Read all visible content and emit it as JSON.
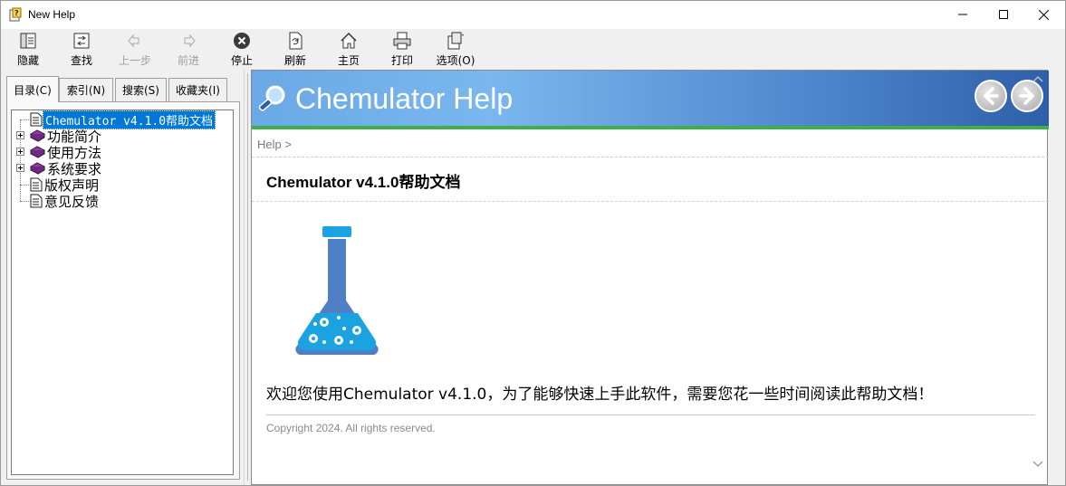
{
  "window": {
    "title": "New Help"
  },
  "toolbar": {
    "items": [
      {
        "label": "隐藏",
        "icon": "hide-icon",
        "enabled": true
      },
      {
        "label": "查找",
        "icon": "locate-icon",
        "enabled": true
      },
      {
        "label": "上一步",
        "icon": "back-arrow-icon",
        "enabled": false
      },
      {
        "label": "前进",
        "icon": "forward-arrow-icon",
        "enabled": false
      },
      {
        "label": "停止",
        "icon": "stop-icon",
        "enabled": true
      },
      {
        "label": "刷新",
        "icon": "refresh-icon",
        "enabled": true
      },
      {
        "label": "主页",
        "icon": "home-icon",
        "enabled": true
      },
      {
        "label": "打印",
        "icon": "print-icon",
        "enabled": true
      },
      {
        "label": "选项(O)",
        "icon": "options-icon",
        "enabled": true
      }
    ]
  },
  "nav": {
    "tabs": [
      {
        "label": "目录(C)",
        "active": true
      },
      {
        "label": "索引(N)",
        "active": false
      },
      {
        "label": "搜索(S)",
        "active": false
      },
      {
        "label": "收藏夹(I)",
        "active": false
      }
    ],
    "tree": [
      {
        "label": "Chemulator v4.1.0帮助文档",
        "type": "page",
        "selected": true
      },
      {
        "label": "功能简介",
        "type": "book",
        "expandable": true
      },
      {
        "label": "使用方法",
        "type": "book",
        "expandable": true
      },
      {
        "label": "系统要求",
        "type": "book",
        "expandable": true
      },
      {
        "label": "版权声明",
        "type": "page"
      },
      {
        "label": "意见反馈",
        "type": "page"
      }
    ]
  },
  "content": {
    "banner_title": "Chemulator Help",
    "breadcrumb": "Help >",
    "doc_title": "Chemulator v4.1.0帮助文档",
    "welcome": "欢迎您使用Chemulator v4.1.0，为了能够快速上手此软件，需要您花一些时间阅读此帮助文档！",
    "copyright": "Copyright  2024. All rights reserved."
  },
  "colors": {
    "selection": "#0078d7",
    "banner_start": "#6aa9e6",
    "banner_end": "#2e5fa8",
    "banner_accent": "#3db04a",
    "flask_blue": "#4f7fc4",
    "flask_liquid": "#1aa3e0"
  }
}
